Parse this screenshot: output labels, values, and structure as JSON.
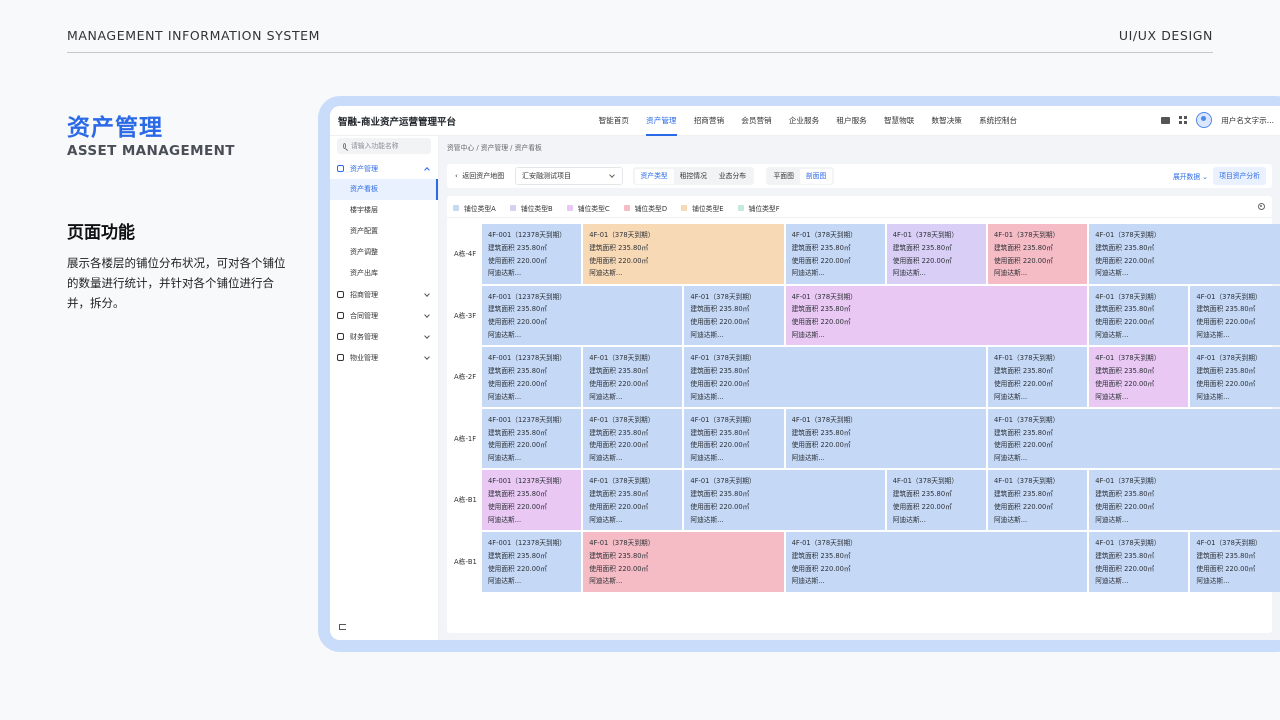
{
  "slide": {
    "top_left": "MANAGEMENT INFORMATION SYSTEM",
    "top_right": "UI/UX DESIGN",
    "title": "资产管理",
    "subtitle": "ASSET MANAGEMENT",
    "feature_title": "页面功能",
    "feature_desc": "展示各楼层的铺位分布状况，可对各个铺位的数量进行统计，并针对各个铺位进行合并，拆分。"
  },
  "app": {
    "brand": "智融-商业资产运营管理平台",
    "menu": [
      "智能首页",
      "资产管理",
      "招商营销",
      "会员营销",
      "企业服务",
      "租户服务",
      "智慧物联",
      "数智决策",
      "系统控制台"
    ],
    "active_menu": 1,
    "user_name": "用户名文字示...",
    "icons": [
      "folder-icon",
      "apps-grid-icon",
      "avatar"
    ]
  },
  "sidebar": {
    "search_placeholder": "请输入功能名称",
    "groups": [
      {
        "label": "资产管理",
        "open": true,
        "items": [
          "资产看板",
          "楼宇楼层",
          "资产配置",
          "资产调整",
          "资产出库"
        ],
        "active_item": 0
      },
      {
        "label": "招商管理",
        "open": false
      },
      {
        "label": "合同管理",
        "open": false
      },
      {
        "label": "财务管理",
        "open": false
      },
      {
        "label": "物业管理",
        "open": false
      }
    ]
  },
  "breadcrumb": "资管中心  /  资产管理  /  资产看板",
  "toolbar": {
    "back": "返回资产地图",
    "project": "汇安融测试项目",
    "seg1": [
      "资产类型",
      "租控情况",
      "业态分布"
    ],
    "seg1_active": 0,
    "seg2": [
      "平面图",
      "剖面图"
    ],
    "seg2_active": 1,
    "expand": "展开数据",
    "analysis": "项目资产分析"
  },
  "legend": [
    {
      "label": "铺位类型A",
      "color": "#c5d9f6"
    },
    {
      "label": "铺位类型B",
      "color": "#d9cff6"
    },
    {
      "label": "铺位类型C",
      "color": "#e9c8f3"
    },
    {
      "label": "铺位类型D",
      "color": "#f6bcc5"
    },
    {
      "label": "铺位类型E",
      "color": "#f8d9b5"
    },
    {
      "label": "铺位类型F",
      "color": "#c4eadb"
    }
  ],
  "colors": {
    "A": "#c5d9f6",
    "B": "#d9cff6",
    "C": "#e9c8f3",
    "D": "#f6bcc5",
    "E": "#f8d9b5",
    "F": "#c4eadb"
  },
  "floors": [
    {
      "label": "A栋-4F",
      "cells": [
        {
          "span": 1,
          "type": "A",
          "code": "4F-001（12378天到期）",
          "area": "建筑面积 235.80㎡",
          "used": "使用面积 220.00㎡",
          "tenant": "阿迪达斯..."
        },
        {
          "span": 2,
          "type": "E",
          "code": "4F-01（378天到期）",
          "area": "建筑面积 235.80㎡",
          "used": "使用面积 220.00㎡",
          "tenant": "阿迪达斯..."
        },
        {
          "span": 1,
          "type": "A",
          "code": "4F-01（378天到期）",
          "area": "建筑面积 235.80㎡",
          "used": "使用面积 220.00㎡",
          "tenant": "阿迪达斯..."
        },
        {
          "span": 1,
          "type": "B",
          "code": "4F-01（378天到期）",
          "area": "建筑面积 235.80㎡",
          "used": "使用面积 220.00㎡",
          "tenant": "阿迪达斯..."
        },
        {
          "span": 1,
          "type": "D",
          "code": "4F-01（378天到期）",
          "area": "建筑面积 235.80㎡",
          "used": "使用面积 220.00㎡",
          "tenant": "阿迪达斯..."
        },
        {
          "span": 2,
          "type": "A",
          "code": "4F-01（378天到期）",
          "area": "建筑面积 235.80㎡",
          "used": "使用面积 220.00㎡",
          "tenant": "阿迪达斯..."
        }
      ]
    },
    {
      "label": "A栋-3F",
      "cells": [
        {
          "span": 2,
          "type": "A",
          "code": "4F-001（12378天到期）",
          "area": "建筑面积 235.80㎡",
          "used": "使用面积 220.00㎡",
          "tenant": "阿迪达斯..."
        },
        {
          "span": 1,
          "type": "A",
          "code": "4F-01（378天到期）",
          "area": "建筑面积 235.80㎡",
          "used": "使用面积 220.00㎡",
          "tenant": "阿迪达斯..."
        },
        {
          "span": 3,
          "type": "C",
          "code": "4F-01（378天到期）",
          "area": "建筑面积 235.80㎡",
          "used": "使用面积 220.00㎡",
          "tenant": "阿迪达斯..."
        },
        {
          "span": 1,
          "type": "A",
          "code": "4F-01（378天到期）",
          "area": "建筑面积 235.80㎡",
          "used": "使用面积 220.00㎡",
          "tenant": "阿迪达斯..."
        },
        {
          "span": 1,
          "type": "A",
          "code": "4F-01（378天到期）",
          "area": "建筑面积 235.80㎡",
          "used": "使用面积 220.00㎡",
          "tenant": "阿迪达斯..."
        }
      ]
    },
    {
      "label": "A栋-2F",
      "cells": [
        {
          "span": 1,
          "type": "A",
          "code": "4F-001（12378天到期）",
          "area": "建筑面积 235.80㎡",
          "used": "使用面积 220.00㎡",
          "tenant": "阿迪达斯..."
        },
        {
          "span": 1,
          "type": "A",
          "code": "4F-01（378天到期）",
          "area": "建筑面积 235.80㎡",
          "used": "使用面积 220.00㎡",
          "tenant": "阿迪达斯..."
        },
        {
          "span": 3,
          "type": "A",
          "code": "4F-01（378天到期）",
          "area": "建筑面积 235.80㎡",
          "used": "使用面积 220.00㎡",
          "tenant": "阿迪达斯..."
        },
        {
          "span": 1,
          "type": "A",
          "code": "4F-01（378天到期）",
          "area": "建筑面积 235.80㎡",
          "used": "使用面积 220.00㎡",
          "tenant": "阿迪达斯..."
        },
        {
          "span": 1,
          "type": "C",
          "code": "4F-01（378天到期）",
          "area": "建筑面积 235.80㎡",
          "used": "使用面积 220.00㎡",
          "tenant": "阿迪达斯..."
        },
        {
          "span": 1,
          "type": "A",
          "code": "4F-01（378天到期）",
          "area": "建筑面积 235.80㎡",
          "used": "使用面积 220.00㎡",
          "tenant": "阿迪达斯..."
        }
      ]
    },
    {
      "label": "A栋-1F",
      "cells": [
        {
          "span": 1,
          "type": "A",
          "code": "4F-001（12378天到期）",
          "area": "建筑面积 235.80㎡",
          "used": "使用面积 220.00㎡",
          "tenant": "阿迪达斯..."
        },
        {
          "span": 1,
          "type": "A",
          "code": "4F-01（378天到期）",
          "area": "建筑面积 235.80㎡",
          "used": "使用面积 220.00㎡",
          "tenant": "阿迪达斯..."
        },
        {
          "span": 1,
          "type": "A",
          "code": "4F-01（378天到期）",
          "area": "建筑面积 235.80㎡",
          "used": "使用面积 220.00㎡",
          "tenant": "阿迪达斯..."
        },
        {
          "span": 2,
          "type": "A",
          "code": "4F-01（378天到期）",
          "area": "建筑面积 235.80㎡",
          "used": "使用面积 220.00㎡",
          "tenant": "阿迪达斯..."
        },
        {
          "span": 3,
          "type": "A",
          "code": "4F-01（378天到期）",
          "area": "建筑面积 235.80㎡",
          "used": "使用面积 220.00㎡",
          "tenant": "阿迪达斯..."
        }
      ]
    },
    {
      "label": "A栋-B1",
      "cells": [
        {
          "span": 1,
          "type": "C",
          "code": "4F-001（12378天到期）",
          "area": "建筑面积 235.80㎡",
          "used": "使用面积 220.00㎡",
          "tenant": "阿迪达斯..."
        },
        {
          "span": 1,
          "type": "A",
          "code": "4F-01（378天到期）",
          "area": "建筑面积 235.80㎡",
          "used": "使用面积 220.00㎡",
          "tenant": "阿迪达斯..."
        },
        {
          "span": 2,
          "type": "A",
          "code": "4F-01（378天到期）",
          "area": "建筑面积 235.80㎡",
          "used": "使用面积 220.00㎡",
          "tenant": "阿迪达斯..."
        },
        {
          "span": 1,
          "type": "A",
          "code": "4F-01（378天到期）",
          "area": "建筑面积 235.80㎡",
          "used": "使用面积 220.00㎡",
          "tenant": "阿迪达斯..."
        },
        {
          "span": 1,
          "type": "A",
          "code": "4F-01（378天到期）",
          "area": "建筑面积 235.80㎡",
          "used": "使用面积 220.00㎡",
          "tenant": "阿迪达斯..."
        },
        {
          "span": 2,
          "type": "A",
          "code": "4F-01（378天到期）",
          "area": "建筑面积 235.80㎡",
          "used": "使用面积 220.00㎡",
          "tenant": "阿迪达斯..."
        }
      ]
    },
    {
      "label": "A栋-B1",
      "cells": [
        {
          "span": 1,
          "type": "A",
          "code": "4F-001（12378天到期）",
          "area": "建筑面积 235.80㎡",
          "used": "使用面积 220.00㎡",
          "tenant": "阿迪达斯..."
        },
        {
          "span": 2,
          "type": "D",
          "code": "4F-01（378天到期）",
          "area": "建筑面积 235.80㎡",
          "used": "使用面积 220.00㎡",
          "tenant": "阿迪达斯..."
        },
        {
          "span": 3,
          "type": "A",
          "code": "4F-01（378天到期）",
          "area": "建筑面积 235.80㎡",
          "used": "使用面积 220.00㎡",
          "tenant": "阿迪达斯..."
        },
        {
          "span": 1,
          "type": "A",
          "code": "4F-01（378天到期）",
          "area": "建筑面积 235.80㎡",
          "used": "使用面积 220.00㎡",
          "tenant": "阿迪达斯..."
        },
        {
          "span": 1,
          "type": "A",
          "code": "4F-01（378天到期）",
          "area": "建筑面积 235.80㎡",
          "used": "使用面积 220.00㎡",
          "tenant": "阿迪达斯..."
        }
      ]
    }
  ]
}
